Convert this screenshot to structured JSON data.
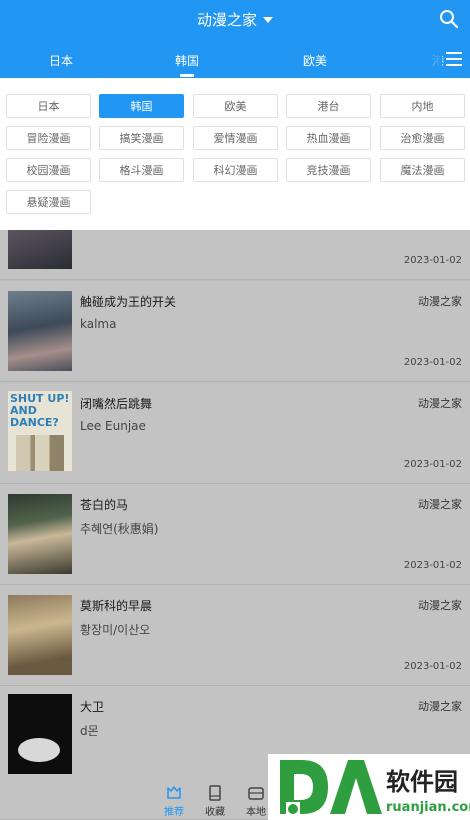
{
  "header": {
    "title": "动漫之家",
    "tabs": [
      "日本",
      "韩国",
      "欧美",
      "港"
    ],
    "active_tab": "韩国",
    "accent_color": "#2196f3"
  },
  "categories": [
    {
      "label": "日本",
      "active": false
    },
    {
      "label": "韩国",
      "active": true
    },
    {
      "label": "欧美",
      "active": false
    },
    {
      "label": "港台",
      "active": false
    },
    {
      "label": "内地",
      "active": false
    },
    {
      "label": "冒险漫画",
      "active": false
    },
    {
      "label": "搞笑漫画",
      "active": false
    },
    {
      "label": "爱情漫画",
      "active": false
    },
    {
      "label": "热血漫画",
      "active": false
    },
    {
      "label": "治愈漫画",
      "active": false
    },
    {
      "label": "校园漫画",
      "active": false
    },
    {
      "label": "格斗漫画",
      "active": false
    },
    {
      "label": "科幻漫画",
      "active": false
    },
    {
      "label": "竞技漫画",
      "active": false
    },
    {
      "label": "魔法漫画",
      "active": false
    },
    {
      "label": "悬疑漫画",
      "active": false
    }
  ],
  "list": [
    {
      "title": "",
      "author": "",
      "source": "",
      "date": "2023-01-02"
    },
    {
      "title": "触碰成为王的开关",
      "author": "kalma",
      "source": "动漫之家",
      "date": "2023-01-02"
    },
    {
      "title": "闭嘴然后跳舞",
      "author": "Lee Eunjae",
      "source": "动漫之家",
      "date": "2023-01-02",
      "cover_text": "SHUT UP! AND DANCE?"
    },
    {
      "title": "苍白的马",
      "author": "추혜연(秋惠娟)",
      "source": "动漫之家",
      "date": "2023-01-02"
    },
    {
      "title": "莫斯科的早晨",
      "author": "황장미/이산오",
      "source": "动漫之家",
      "date": "2023-01-02"
    },
    {
      "title": "大卫",
      "author": "d몬",
      "source": "动漫之家",
      "date": ""
    }
  ],
  "bottom_nav": [
    {
      "label": "推荐",
      "icon": "recommend-icon",
      "active": true
    },
    {
      "label": "收藏",
      "icon": "bookmark-icon",
      "active": false
    },
    {
      "label": "本地",
      "icon": "storage-icon",
      "active": false
    }
  ],
  "watermark": {
    "logo": "DA",
    "brand": "软件园",
    "domain": "ruanjian.com"
  }
}
